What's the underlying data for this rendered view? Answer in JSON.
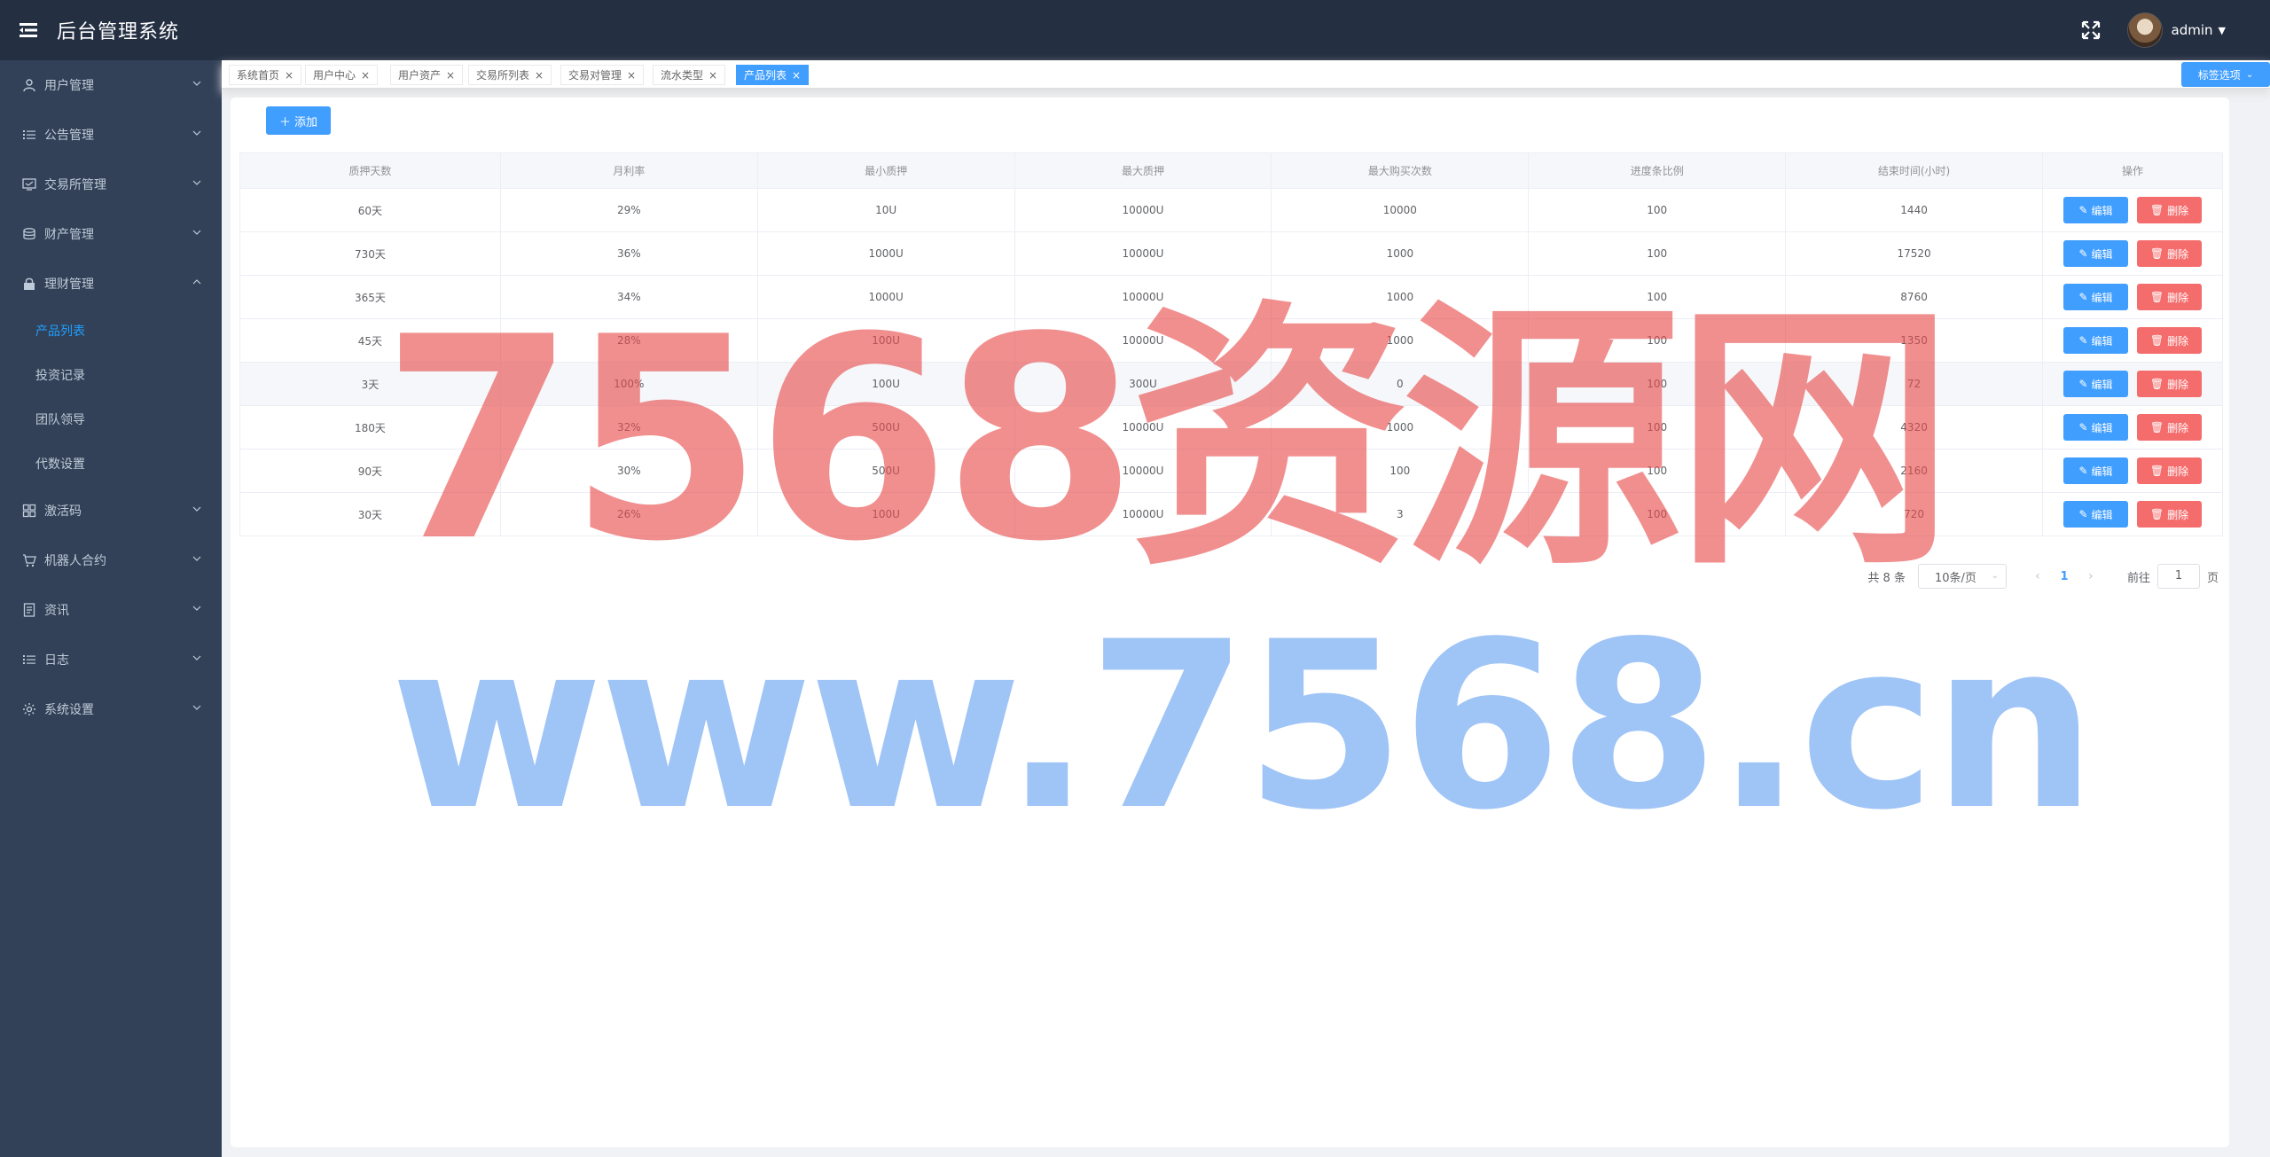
{
  "header": {
    "title": "后台管理系统",
    "username": "admin"
  },
  "sidebar": {
    "items": [
      {
        "label": "用户管理",
        "icon": "user-icon"
      },
      {
        "label": "公告管理",
        "icon": "list-icon"
      },
      {
        "label": "交易所管理",
        "icon": "exchange-icon"
      },
      {
        "label": "财产管理",
        "icon": "coins-icon"
      },
      {
        "label": "理财管理",
        "icon": "lock-icon",
        "open": true,
        "children": [
          {
            "label": "产品列表",
            "active": true
          },
          {
            "label": "投资记录"
          },
          {
            "label": "团队领导"
          },
          {
            "label": "代数设置"
          }
        ]
      },
      {
        "label": "激活码",
        "icon": "grid-icon"
      },
      {
        "label": "机器人合约",
        "icon": "cart-icon"
      },
      {
        "label": "资讯",
        "icon": "document-icon"
      },
      {
        "label": "日志",
        "icon": "list-icon"
      },
      {
        "label": "系统设置",
        "icon": "gear-icon"
      }
    ]
  },
  "tags": {
    "items": [
      {
        "label": "系统首页",
        "active": false
      },
      {
        "label": "用户中心",
        "active": false
      },
      {
        "label": "用户资产",
        "active": false
      },
      {
        "label": "交易所列表",
        "active": false
      },
      {
        "label": "交易对管理",
        "active": false
      },
      {
        "label": "流水类型",
        "active": false
      },
      {
        "label": "产品列表",
        "active": true
      }
    ],
    "option_label": "标签选项"
  },
  "toolbar": {
    "add_label": "添加"
  },
  "table": {
    "columns": [
      "质押天数",
      "月利率",
      "最小质押",
      "最大质押",
      "最大购买次数",
      "进度条比例",
      "结束时间(小时)",
      "操作"
    ],
    "rows": [
      [
        "60天",
        "29%",
        "10U",
        "10000U",
        "10000",
        "100",
        "1440"
      ],
      [
        "730天",
        "36%",
        "1000U",
        "10000U",
        "1000",
        "100",
        "17520"
      ],
      [
        "365天",
        "34%",
        "1000U",
        "10000U",
        "1000",
        "100",
        "8760"
      ],
      [
        "45天",
        "28%",
        "100U",
        "10000U",
        "1000",
        "100",
        "1350"
      ],
      [
        "3天",
        "100%",
        "100U",
        "300U",
        "0",
        "100",
        "72"
      ],
      [
        "180天",
        "32%",
        "500U",
        "10000U",
        "1000",
        "100",
        "4320"
      ],
      [
        "90天",
        "30%",
        "500U",
        "10000U",
        "100",
        "100",
        "2160"
      ],
      [
        "30天",
        "26%",
        "100U",
        "10000U",
        "3",
        "100",
        "720"
      ]
    ],
    "edit_label": "编辑",
    "delete_label": "删除"
  },
  "pagination": {
    "total_text": "共 8 条",
    "page_size": "10条/页",
    "current_page": "1",
    "jump_prefix": "前往",
    "jump_value": "1",
    "jump_suffix": "页"
  },
  "watermark": {
    "line1": "7568资源网",
    "line2": "www.7568.cn"
  },
  "colors": {
    "header_bg": "#242f42",
    "sidebar_bg": "#324157",
    "primary": "#409eff",
    "danger": "#f56c6c",
    "active_menu": "#20a0ff"
  }
}
